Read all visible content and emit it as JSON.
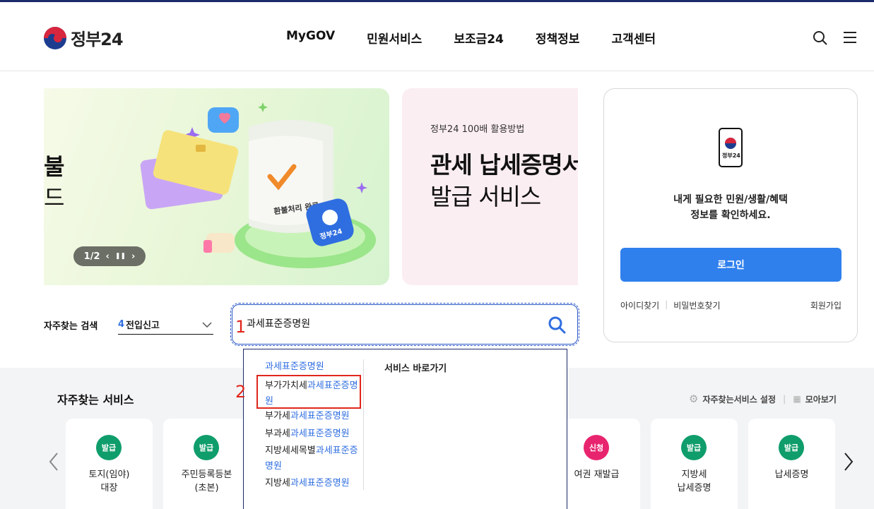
{
  "header": {
    "logo_text": "정부24",
    "nav": [
      "MyGOV",
      "민원서비스",
      "보조금24",
      "정책정보",
      "고객센터"
    ]
  },
  "banner1": {
    "text_line1": "불",
    "text_line2": "드",
    "card_text": "환불처리 완료",
    "badge_text": "정부24",
    "counter": "1/2"
  },
  "banner2": {
    "subtitle": "정부24 100배 활용방법",
    "title_line1": "관세 납세증명서",
    "title_line2": "발급 서비스"
  },
  "login": {
    "phone_label": "정부24",
    "message_line1": "내게 필요한 민원/생활/혜택",
    "message_line2": "정보를 확인하세요.",
    "login_button": "로그인",
    "find_id": "아이디찾기",
    "find_password": "비밀번호찾기",
    "join": "회원가입"
  },
  "search": {
    "freq_label": "자주찾는 검색",
    "freq_rank": "4",
    "freq_selected": "전입신고",
    "query": "과세표준증명원"
  },
  "annotations": {
    "one": "1",
    "two": "2"
  },
  "dropdown": {
    "items": [
      {
        "prefix": "",
        "highlight": "과세표준증명원"
      },
      {
        "prefix": "부가가치세",
        "highlight": "과세표준증명",
        "suffix": "원"
      },
      {
        "prefix": "부가세",
        "highlight": "과세표준증명원"
      },
      {
        "prefix": "부과세",
        "highlight": "과세표준증명원"
      },
      {
        "prefix": "지방세세목별",
        "highlight": "과세표준증",
        "suffix": "명원"
      },
      {
        "prefix": "지방세",
        "highlight": "과세표준증명원"
      }
    ],
    "right_title": "서비스 바로가기"
  },
  "frequent_services": {
    "title": "자주찾는 서비스",
    "settings": "자주찾는서비스 설정",
    "view_all": "모아보기",
    "cards": [
      {
        "badge": "발급",
        "label_line1": "토지(임야)",
        "label_line2": "대장",
        "color": "#0f9d6b"
      },
      {
        "badge": "발급",
        "label_line1": "주민등록등본",
        "label_line2": "(초본)",
        "color": "#0f9d6b"
      },
      {
        "badge": "신청",
        "label_line1": "여권 재발급",
        "label_line2": "",
        "color": "#e8246f"
      },
      {
        "badge": "발급",
        "label_line1": "지방세",
        "label_line2": "납세증명",
        "color": "#0f9d6b"
      },
      {
        "badge": "발급",
        "label_line1": "납세증명",
        "label_line2": "",
        "color": "#0f9d6b"
      }
    ]
  }
}
